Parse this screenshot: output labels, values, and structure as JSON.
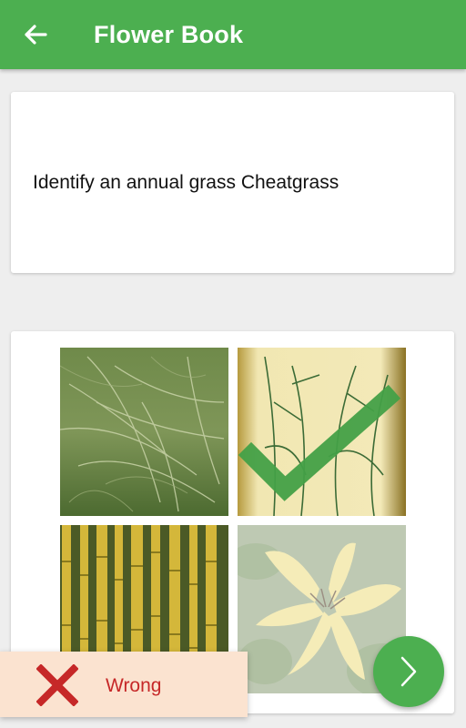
{
  "app": {
    "title": "Flower Book",
    "back_icon": "arrow-left-icon",
    "bar_color": "#4caf50"
  },
  "question": {
    "text": "Identify an annual grass Cheatgrass"
  },
  "options": [
    {
      "name": "cheatgrass-photo",
      "state": "normal"
    },
    {
      "name": "grass-illustration",
      "state": "correct",
      "overlay_icon": "checkmark-icon"
    },
    {
      "name": "bamboo-photo",
      "state": "normal"
    },
    {
      "name": "yellow-lily-photo",
      "state": "selected-wrong"
    }
  ],
  "feedback": {
    "label": "Wrong",
    "icon": "x-mark-icon",
    "text_color": "#c62828",
    "background": "#fbe3d0"
  },
  "next_button": {
    "icon": "chevron-right-icon"
  }
}
